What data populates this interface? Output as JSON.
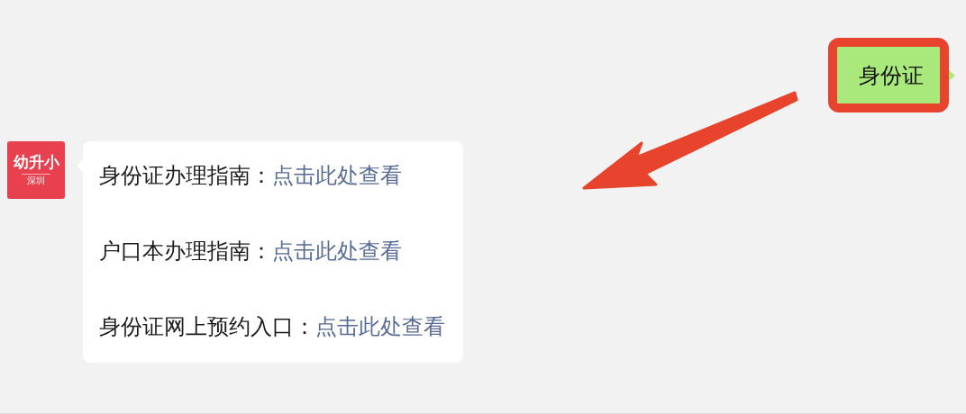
{
  "sent_message": {
    "text": "身份证",
    "highlighted": true
  },
  "received_message": {
    "avatar": {
      "title": "幼升小",
      "subtitle": "深圳"
    },
    "lines": [
      {
        "label": "身份证办理指南：",
        "link": "点击此处查看"
      },
      {
        "label": "户口本办理指南：",
        "link": "点击此处查看"
      },
      {
        "label": "身份证网上预约入口：",
        "link": "点击此处查看"
      }
    ]
  },
  "annotation_arrow": true
}
